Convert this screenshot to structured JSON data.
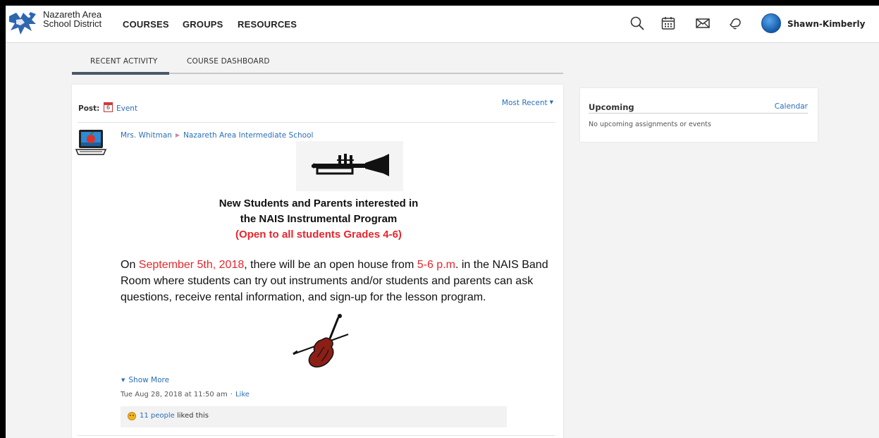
{
  "header": {
    "district_line1": "Nazareth Area",
    "district_line2": "School District",
    "nav": [
      "COURSES",
      "GROUPS",
      "RESOURCES"
    ],
    "icons": [
      "search-icon",
      "calendar-icon",
      "mail-icon",
      "bell-icon"
    ],
    "user_name": "Shawn-Kimberly"
  },
  "tabs": {
    "recent_activity": "RECENT ACTIVITY",
    "course_dashboard": "COURSE DASHBOARD",
    "active": "RECENT ACTIVITY"
  },
  "feed": {
    "post_label": "Post:",
    "post_type_icon_number": "6",
    "post_type": "Event",
    "sort_label": "Most Recent",
    "author": "Mrs. Whitman",
    "location": "Nazareth Area Intermediate School",
    "flyer": {
      "title_line1": "New Students and Parents interested in",
      "title_line2": "the NAIS Instrumental Program",
      "title_line3": "(Open to all students Grades 4-6)",
      "body_part1": "On ",
      "body_date": "September 5th, 2018",
      "body_part2": ", there will be an open house from ",
      "body_time": "5-6 p.m",
      "body_part3": ". in the NAIS Band Room where students can try out instruments and/or students and parents can ask questions, receive rental information, and sign-up for the lesson program."
    },
    "show_more": "Show More",
    "timestamp": "Tue Aug 28, 2018 at 11:50 am",
    "dot": "·",
    "like_label": "Like",
    "likes_count": "11 people",
    "likes_suffix": " liked this"
  },
  "upcoming": {
    "title": "Upcoming",
    "calendar_link": "Calendar",
    "empty_message": "No upcoming assignments or events"
  },
  "colors": {
    "link": "#2a6fb8",
    "highlight_red": "#e8262d",
    "tab_indicator": "#48586a",
    "page_bg": "#f3f3f3"
  }
}
